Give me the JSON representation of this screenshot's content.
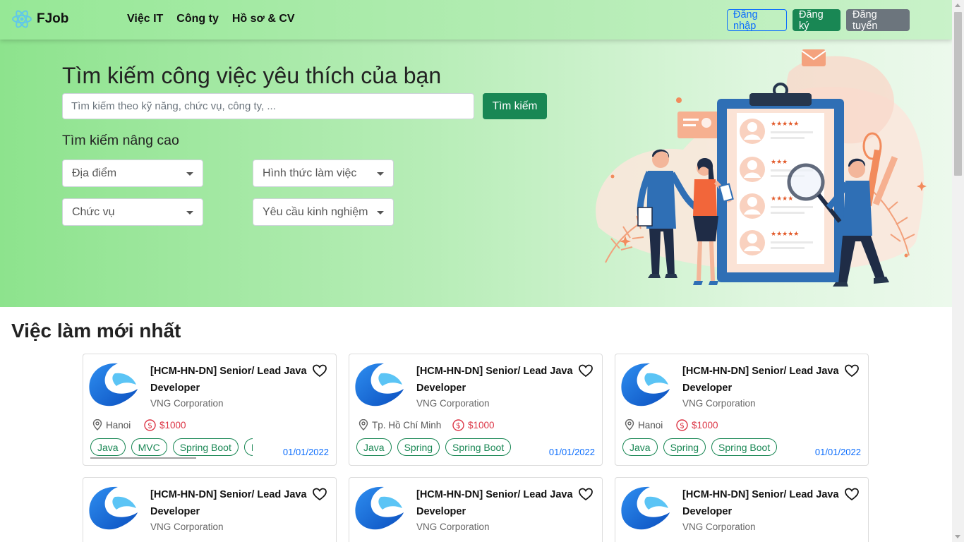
{
  "brand": {
    "name": "FJob",
    "icon": "react-atom-icon"
  },
  "nav": {
    "links": [
      "Việc IT",
      "Công ty",
      "Hồ sơ & CV"
    ]
  },
  "auth": {
    "login": "Đăng nhập",
    "register": "Đăng ký",
    "post_job": "Đăng tuyển"
  },
  "hero": {
    "title": "Tìm kiếm công việc yêu thích của bạn",
    "search_placeholder": "Tìm kiếm theo kỹ năng, chức vụ, công ty, ...",
    "search_button": "Tìm kiếm",
    "advanced_title": "Tìm kiếm nâng cao",
    "filters": {
      "location": "Địa điểm",
      "work_type": "Hình thức làm việc",
      "position": "Chức vụ",
      "experience": "Yêu cầu kinh nghiệm"
    }
  },
  "jobs": {
    "title": "Việc làm mới nhất",
    "items": [
      {
        "title": "[HCM-HN-DN] Senior/ Lead Java Developer",
        "company": "VNG Corporation",
        "location": "Hanoi",
        "salary": "$1000",
        "tags": [
          "Java",
          "MVC",
          "Spring Boot",
          "Pe"
        ],
        "date": "01/01/2022"
      },
      {
        "title": "[HCM-HN-DN] Senior/ Lead Java Developer",
        "company": "VNG Corporation",
        "location": "Tp. Hồ Chí Minh",
        "salary": "$1000",
        "tags": [
          "Java",
          "Spring",
          "Spring Boot"
        ],
        "date": "01/01/2022"
      },
      {
        "title": "[HCM-HN-DN] Senior/ Lead Java Developer",
        "company": "VNG Corporation",
        "location": "Hanoi",
        "salary": "$1000",
        "tags": [
          "Java",
          "Spring",
          "Spring Boot"
        ],
        "date": "01/01/2022"
      },
      {
        "title": "[HCM-HN-DN] Senior/ Lead Java Developer",
        "company": "VNG Corporation"
      },
      {
        "title": "[HCM-HN-DN] Senior/ Lead Java Developer",
        "company": "VNG Corporation"
      },
      {
        "title": "[HCM-HN-DN] Senior/ Lead Java Developer",
        "company": "VNG Corporation"
      }
    ]
  },
  "colors": {
    "primary_green": "#198754",
    "blue": "#0d6efd",
    "salary_red": "#dc3545",
    "secondary": "#6c757d"
  }
}
